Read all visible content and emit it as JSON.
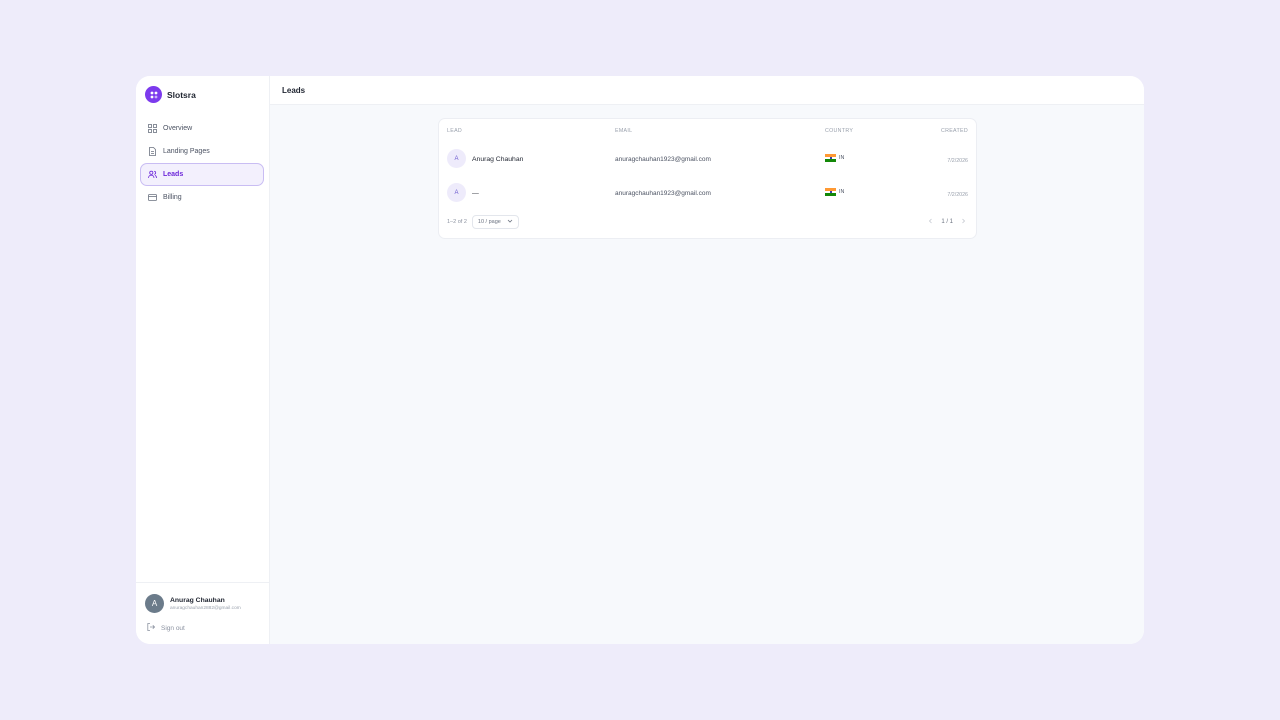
{
  "app": {
    "name": "Slotsra"
  },
  "sidebar": {
    "items": [
      {
        "label": "Overview",
        "icon": "grid-icon",
        "active": false
      },
      {
        "label": "Landing Pages",
        "icon": "document-icon",
        "active": false
      },
      {
        "label": "Leads",
        "icon": "users-icon",
        "active": true
      },
      {
        "label": "Billing",
        "icon": "credit-card-icon",
        "active": false
      }
    ],
    "user": {
      "initial": "A",
      "name": "Anurag Chauhan",
      "email": "anuragchauhan2882@gmail.com"
    },
    "signout_label": "Sign out"
  },
  "header": {
    "title": "Leads"
  },
  "table": {
    "columns": {
      "lead": "LEAD",
      "email": "EMAIL",
      "country": "COUNTRY",
      "created": "CREATED"
    },
    "rows": [
      {
        "initial": "A",
        "name": "Anurag Chauhan",
        "email": "anuragchauhan1923@gmail.com",
        "country": "IN",
        "created": "7/2/2026"
      },
      {
        "initial": "A",
        "name": "—",
        "email": "anuragchauhan1923@gmail.com",
        "country": "IN",
        "created": "7/2/2026"
      }
    ],
    "footer": {
      "range": "1–2 of 2",
      "page_size": "10 / page",
      "page": "1 / 1"
    }
  },
  "colors": {
    "accent": "#7c3aed",
    "background": "#eeecfa"
  }
}
